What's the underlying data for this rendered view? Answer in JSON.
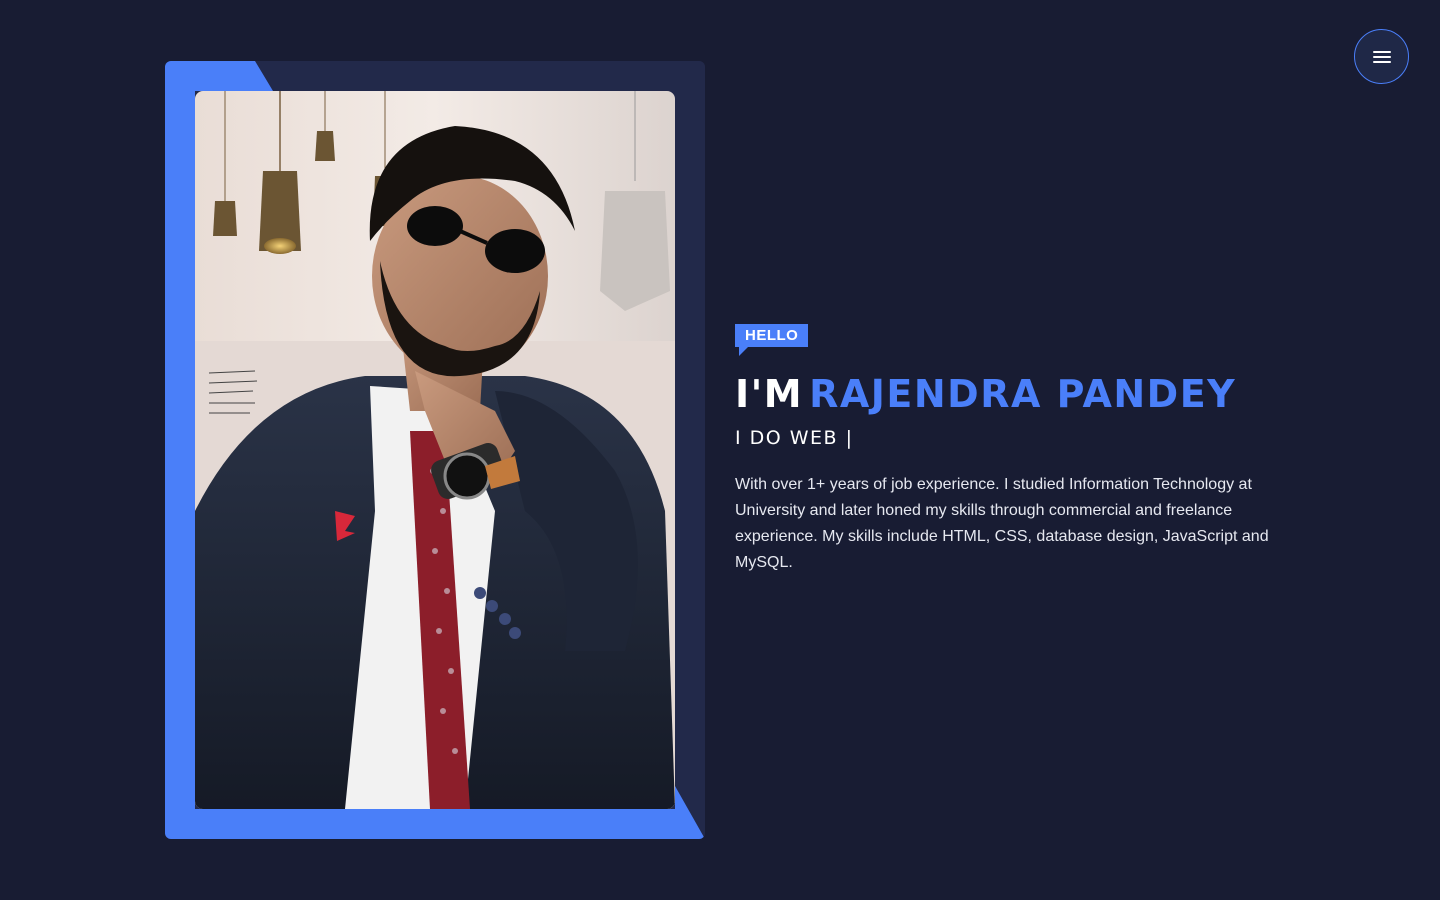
{
  "menu": {
    "icon": "hamburger-icon"
  },
  "profile_photo": {
    "alt": "Portrait photo"
  },
  "intro": {
    "greeting": "HELLO",
    "prefix": "I'M",
    "name": "RAJENDRA PANDEY",
    "tagline": "I DO WEB |",
    "bio": "With over 1+ years of job experience. I studied Information Technology at University and later honed my skills through commercial and freelance experience. My skills include HTML, CSS, database design, JavaScript and MySQL."
  },
  "colors": {
    "background": "#181c33",
    "card": "#22294a",
    "accent": "#4a7ff9",
    "text": "#ffffff"
  }
}
